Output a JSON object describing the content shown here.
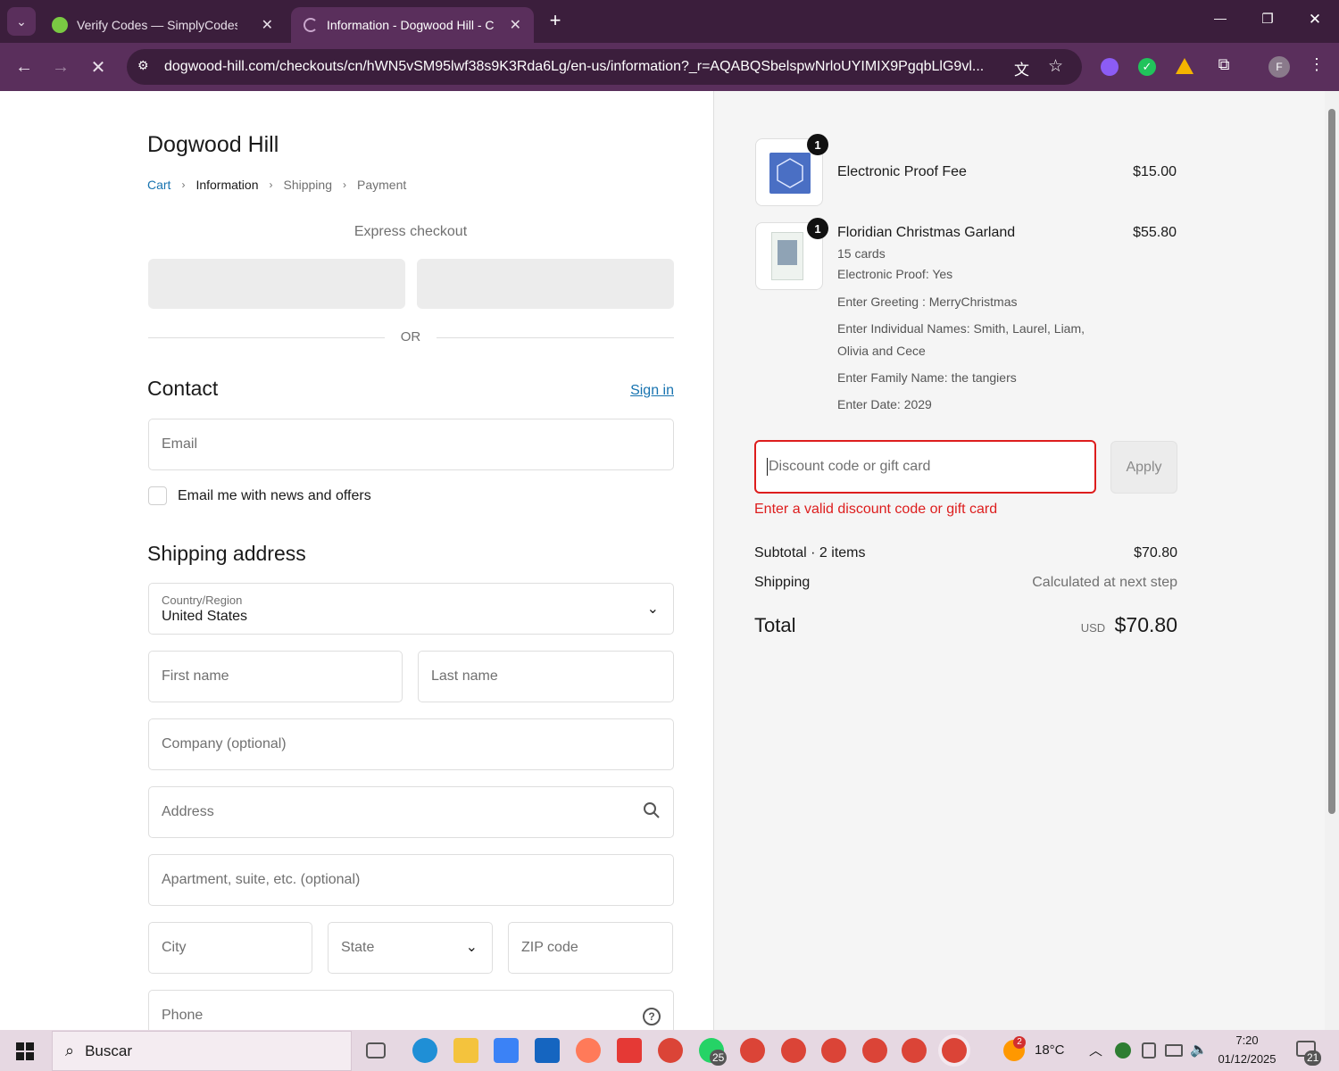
{
  "browser": {
    "tabs": [
      {
        "title": "Verify Codes — SimplyCodes",
        "close": "✕"
      },
      {
        "title": "Information - Dogwood Hill - C",
        "close": "✕"
      }
    ],
    "new_tab": "+",
    "url": "dogwood-hill.com/checkouts/cn/hWN5vSM95lwf38s9K3Rda6Lg/en-us/information?_r=AQABQSbelspwNrloUYIMIX9PgqbLlG9vl...",
    "profile_initial": "F",
    "window_controls": {
      "minimize": "—",
      "restore": "❐",
      "close": "✕"
    }
  },
  "checkout": {
    "shop_name": "Dogwood Hill",
    "breadcrumbs": [
      {
        "label": "Cart"
      },
      {
        "label": "Information"
      },
      {
        "label": "Shipping"
      },
      {
        "label": "Payment"
      }
    ],
    "crumb_sep": "›",
    "express_checkout": "Express checkout",
    "or": "OR",
    "contact": {
      "heading": "Contact",
      "sign_in": "Sign in",
      "email_placeholder": "Email",
      "newsletter_label": "Email me with news and offers"
    },
    "shipping": {
      "heading": "Shipping address",
      "country_label": "Country/Region",
      "country_value": "United States",
      "first_name": "First name",
      "last_name": "Last name",
      "company": "Company (optional)",
      "address": "Address",
      "apartment": "Apartment, suite, etc. (optional)",
      "city": "City",
      "state": "State",
      "zip": "ZIP code",
      "phone": "Phone"
    }
  },
  "summary": {
    "items": [
      {
        "qty": "1",
        "name": "Electronic Proof Fee",
        "price": "$15.00",
        "meta": []
      },
      {
        "qty": "1",
        "name": "Floridian Christmas Garland",
        "price": "$55.80",
        "meta": [
          "15 cards",
          "Electronic Proof: Yes",
          "Enter Greeting : MerryChristmas",
          "Enter Individual Names: Smith, Laurel, Liam,",
          "Olivia and Cece",
          "Enter Family Name: the tangiers",
          "Enter Date: 2029"
        ]
      }
    ],
    "discount_placeholder": "Discount code or gift card",
    "apply_label": "Apply",
    "discount_error": "Enter a valid discount code or gift card",
    "subtotal_label": "Subtotal · 2 items",
    "subtotal_value": "$70.80",
    "shipping_label": "Shipping",
    "shipping_value": "Calculated at next step",
    "total_label": "Total",
    "total_currency": "USD",
    "total_value": "$70.80"
  },
  "taskbar": {
    "search_placeholder": "Buscar",
    "weather_badge": "2",
    "temperature": "18°C",
    "time": "7:20",
    "date": "01/12/2025",
    "notification_count": "21",
    "whatsapp_count": "25"
  },
  "colors": {
    "tab_bar": "#3b1e3c",
    "toolbar": "#5a2f5c",
    "link": "#1773b0",
    "error": "#dd1d1d",
    "summary_bg": "#f5f5f5"
  }
}
